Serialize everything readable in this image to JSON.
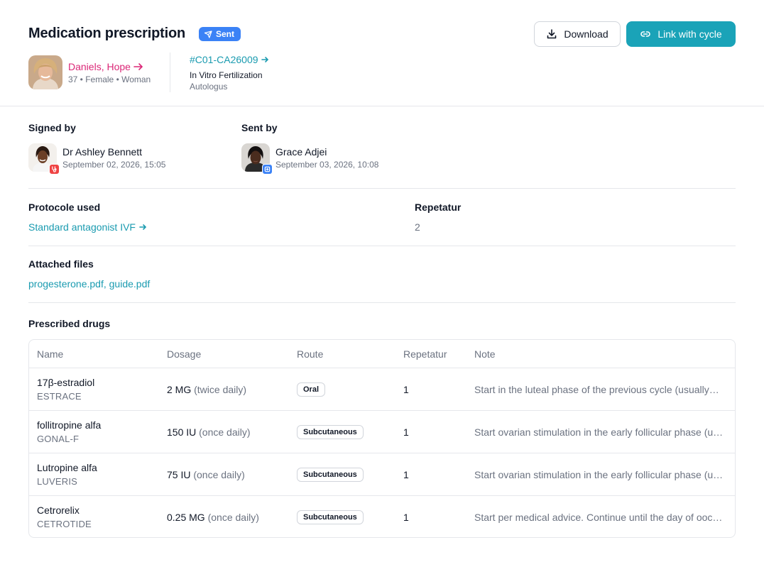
{
  "header": {
    "title": "Medication prescription",
    "status_badge": "Sent",
    "download_label": "Download",
    "link_cycle_label": "Link with cycle"
  },
  "patient": {
    "name": "Daniels, Hope",
    "meta": "37 • Female • Woman"
  },
  "cycle": {
    "id": "#C01-CA26009",
    "type": "In Vitro Fertilization",
    "subtype": "Autologus"
  },
  "signed_by": {
    "label": "Signed by",
    "name": "Dr Ashley Bennett",
    "date": "September 02, 2026, 15:05"
  },
  "sent_by": {
    "label": "Sent by",
    "name": "Grace Adjei",
    "date": "September 03, 2026, 10:08"
  },
  "protocol": {
    "label": "Protocole used",
    "value": "Standard antagonist IVF"
  },
  "repetatur": {
    "label": "Repetatur",
    "value": "2"
  },
  "attachments": {
    "label": "Attached files",
    "value": "progesterone.pdf, guide.pdf"
  },
  "drugs": {
    "label": "Prescribed drugs",
    "columns": [
      "Name",
      "Dosage",
      "Route",
      "Repetatur",
      "Note"
    ],
    "rows": [
      {
        "name": "17β-estradiol",
        "brand": "ESTRACE",
        "dose": "2 MG",
        "freq": "(twice daily)",
        "route": "Oral",
        "rep": "1",
        "note": "Start in the luteal phase of the previous cycle (usually…"
      },
      {
        "name": "follitropine alfa",
        "brand": "GONAL-F",
        "dose": "150 IU",
        "freq": "(once daily)",
        "route": "Subcutaneous",
        "rep": "1",
        "note": "Start ovarian stimulation in the early follicular phase (u…"
      },
      {
        "name": "Lutropine alfa",
        "brand": "LUVERIS",
        "dose": "75 IU",
        "freq": "(once daily)",
        "route": "Subcutaneous",
        "rep": "1",
        "note": "Start ovarian stimulation in the early follicular phase (u…"
      },
      {
        "name": "Cetrorelix",
        "brand": "CETROTIDE",
        "dose": "0.25 MG",
        "freq": "(once daily)",
        "route": "Subcutaneous",
        "rep": "1",
        "note": "Start per medical advice. Continue until the day of ooc…"
      }
    ]
  },
  "colors": {
    "accent": "#1aa3b8",
    "badge_blue": "#3b82f6",
    "patient_pink": "#db2777",
    "doctor_badge_red": "#ef4444"
  },
  "icons": {
    "sent": "paper-plane-icon",
    "download": "download-icon",
    "link": "link-icon",
    "arrow": "arrow-right-icon",
    "doctor_role": "stethoscope-icon",
    "staff_role": "medical-cross-icon"
  }
}
